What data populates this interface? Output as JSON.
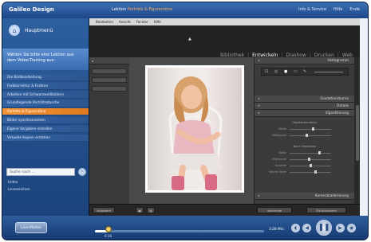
{
  "window": {
    "logo": "Galileo Design",
    "breadcrumb_prefix": "Lektion",
    "breadcrumb_current": "Porträts & Figurentöne",
    "nav": [
      "Info & Service",
      "Hilfe",
      "Ende"
    ]
  },
  "sidebar": {
    "home_label": "Hauptmenü",
    "promo_text": "Wählen Sie bitte eine Lektion aus dem Video-Training aus:",
    "items": [
      {
        "label": "Die Bildbearbeitung",
        "active": false
      },
      {
        "label": "Farbkorrektur & Farbton",
        "active": false
      },
      {
        "label": "Arbeiten mit Schwarzweißbildern",
        "active": false
      },
      {
        "label": "Grundlegende Porträtretusche",
        "active": false
      },
      {
        "label": "Porträts & Figurentöne",
        "active": true
      },
      {
        "label": "Bilder synchronisieren",
        "active": false
      },
      {
        "label": "Eigene Vorgaben erstellen",
        "active": false
      },
      {
        "label": "Virtuelle Kopien erstellen",
        "active": false
      }
    ],
    "search_placeholder": "Suche nach ...",
    "links": [
      "Index",
      "Lesezeichen"
    ]
  },
  "lightroom": {
    "menubar": [
      "Bearbeiten",
      "Ansicht",
      "Fenster",
      "Hilfe"
    ],
    "modules": [
      "Bibliothek",
      "Entwickeln",
      "Diashow",
      "Drucken",
      "Web"
    ],
    "active_module": "Entwickeln",
    "right_panel": {
      "histogram": "Histogramm",
      "tone_curve": "Gradationskurve",
      "detail": "Details",
      "vignette": "Vignettierung",
      "section1": "Objektivkorrektur",
      "section1_rows": [
        {
          "label": "Stärke",
          "value": 0.55
        },
        {
          "label": "Mittelpunkt",
          "value": 0.4
        }
      ],
      "section2": "Nach Freistellen",
      "section2_rows": [
        {
          "label": "Stärke",
          "value": 0.7
        },
        {
          "label": "Mittelpunkt",
          "value": 0.45
        },
        {
          "label": "Rundheit",
          "value": 0.5
        },
        {
          "label": "Weiche Kante",
          "value": 0.6
        }
      ],
      "camera_calibration": "Kamerakalibrierung"
    },
    "bottom_left_button": "Vorgaben",
    "bottom_right_buttons": [
      "Vorherige",
      "Zurücksetzen"
    ]
  },
  "player": {
    "live_mode": "Live-Modus",
    "current_time": "0:16",
    "total_time": "3:28 Min.",
    "progress": 0.08
  }
}
